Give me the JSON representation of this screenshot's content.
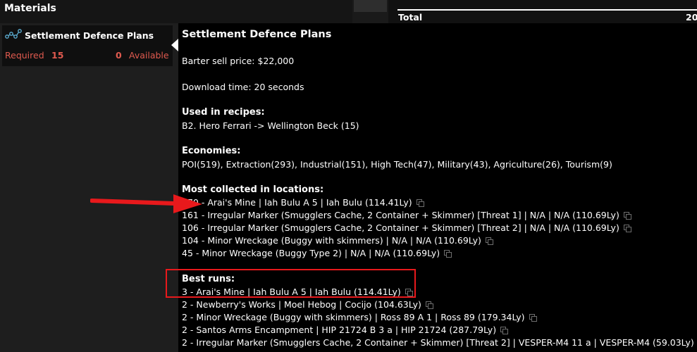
{
  "panel": {
    "title": "Materials"
  },
  "material": {
    "name": "Settlement Defence Plans",
    "required_label": "Required",
    "required_count": "15",
    "available_count": "0",
    "available_label": "Available"
  },
  "totals": {
    "label": "Total",
    "value": "20"
  },
  "tooltip": {
    "title": "Settlement Defence Plans",
    "barter": "Barter sell price: $22,000",
    "download": "Download time: 20 seconds",
    "recipes_heading": "Used in recipes:",
    "recipes": [
      "B2. Hero Ferrari -> Wellington Beck (15)"
    ],
    "economies_heading": "Economies:",
    "economies": "POI(519), Extraction(293), Industrial(151), High Tech(47), Military(43), Agriculture(26), Tourism(9)",
    "locations_heading": "Most collected in locations:",
    "locations": [
      "170 - Arai's Mine | Iah Bulu A 5 | Iah Bulu (114.41Ly)",
      "161 - Irregular Marker (Smugglers Cache, 2 Container + Skimmer) [Threat 1] | N/A | N/A (110.69Ly)",
      "106 - Irregular Marker (Smugglers Cache, 2 Container + Skimmer) [Threat 2] | N/A | N/A (110.69Ly)",
      "104 - Minor Wreckage (Buggy with skimmers) | N/A | N/A (110.69Ly)",
      "45 - Minor Wreckage (Buggy Type 2) | N/A | N/A (110.69Ly)"
    ],
    "best_runs_heading": "Best runs:",
    "best_runs": [
      "3 - Arai's Mine | Iah Bulu A 5 | Iah Bulu (114.41Ly)",
      "2 - Newberry's Works | Moel Hebog | Cocijo (104.63Ly)",
      "2 - Minor Wreckage (Buggy with skimmers) | Ross 89 A 1 | Ross 89 (179.34Ly)",
      "2 - Santos Arms Encampment | HIP 21724 B 3 a | HIP 21724 (287.79Ly)",
      "2 - Irregular Marker (Smugglers Cache, 2 Container + Skimmer) [Threat 2] | VESPER-M4 11 a | VESPER-M4 (59.03Ly)"
    ]
  },
  "colors": {
    "shortage_text": "#e05a4f",
    "annotation_red": "#e8191c",
    "tooltip_bg": "#000000",
    "panel_bg": "#1e1e1e"
  },
  "icons": {
    "material": "material-molecule-icon",
    "copy": "copy-icon"
  }
}
